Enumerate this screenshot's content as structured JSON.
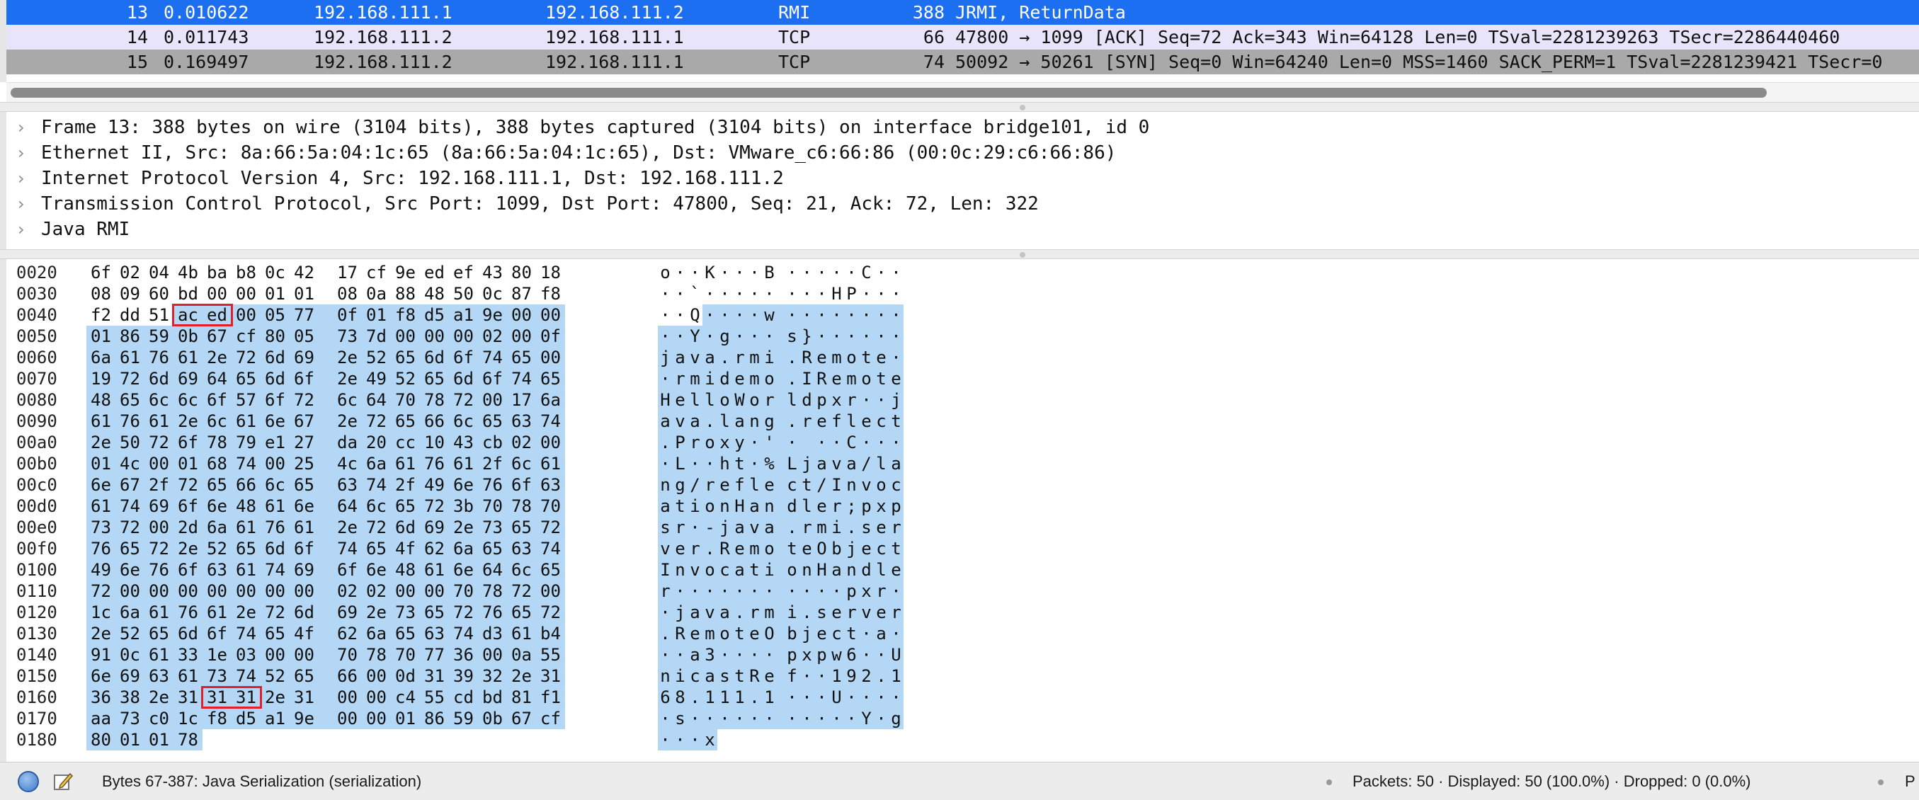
{
  "packet_list": {
    "rows": [
      {
        "no": "13",
        "time": "0.010622",
        "src": "192.168.111.1",
        "dst": "192.168.111.2",
        "proto": "RMI",
        "len": "388",
        "info": "JRMI, ReturnData"
      },
      {
        "no": "14",
        "time": "0.011743",
        "src": "192.168.111.2",
        "dst": "192.168.111.1",
        "proto": "TCP",
        "len": "66",
        "info": "47800 → 1099 [ACK] Seq=72 Ack=343 Win=64128 Len=0 TSval=2281239263 TSecr=2286440460"
      },
      {
        "no": "15",
        "time": "0.169497",
        "src": "192.168.111.2",
        "dst": "192.168.111.1",
        "proto": "TCP",
        "len": "74",
        "info": "50092 → 50261 [SYN] Seq=0 Win=64240 Len=0 MSS=1460 SACK_PERM=1 TSval=2281239421 TSecr=0"
      }
    ],
    "colors": {
      "selected": "#1d6ff2",
      "ack": "#e8e4fa",
      "syn": "#a9a9a9"
    }
  },
  "details": {
    "items": [
      {
        "label": "Frame 13: 388 bytes on wire (3104 bits), 388 bytes captured (3104 bits) on interface bridge101, id 0"
      },
      {
        "label": "Ethernet II, Src: 8a:66:5a:04:1c:65 (8a:66:5a:04:1c:65), Dst: VMware_c6:66:86 (00:0c:29:c6:66:86)"
      },
      {
        "label": "Internet Protocol Version 4, Src: 192.168.111.1, Dst: 192.168.111.2"
      },
      {
        "label": "Transmission Control Protocol, Src Port: 1099, Dst Port: 47800, Seq: 21, Ack: 72, Len: 322"
      },
      {
        "label": "Java RMI"
      }
    ],
    "collapsed_icon": "chevron-right-icon"
  },
  "bytes": {
    "highlight": {
      "start": 67,
      "end": 387,
      "color": "#b3d7f5"
    },
    "marked_ranges": [
      [
        67,
        68
      ],
      [
        356,
        357
      ]
    ],
    "mark_color": "#e0202a",
    "lines": [
      {
        "offset": "0020",
        "hex": [
          "6f",
          "02",
          "04",
          "4b",
          "ba",
          "b8",
          "0c",
          "42",
          "17",
          "cf",
          "9e",
          "ed",
          "ef",
          "43",
          "80",
          "18"
        ],
        "ascii": [
          "o",
          "·",
          "·",
          "K",
          "·",
          "·",
          "·",
          "B",
          "·",
          "·",
          "·",
          "·",
          "·",
          "C",
          "·",
          "·"
        ]
      },
      {
        "offset": "0030",
        "hex": [
          "08",
          "09",
          "60",
          "bd",
          "00",
          "00",
          "01",
          "01",
          "08",
          "0a",
          "88",
          "48",
          "50",
          "0c",
          "87",
          "f8"
        ],
        "ascii": [
          "·",
          "·",
          "`",
          "·",
          "·",
          "·",
          "·",
          "·",
          "·",
          "·",
          "·",
          "H",
          "P",
          "·",
          "·",
          "·"
        ]
      },
      {
        "offset": "0040",
        "hex": [
          "f2",
          "dd",
          "51",
          "ac",
          "ed",
          "00",
          "05",
          "77",
          "0f",
          "01",
          "f8",
          "d5",
          "a1",
          "9e",
          "00",
          "00"
        ],
        "ascii": [
          "·",
          "·",
          "Q",
          "·",
          "·",
          "·",
          "·",
          "w",
          "·",
          "·",
          "·",
          "·",
          "·",
          "·",
          "·",
          "·"
        ]
      },
      {
        "offset": "0050",
        "hex": [
          "01",
          "86",
          "59",
          "0b",
          "67",
          "cf",
          "80",
          "05",
          "73",
          "7d",
          "00",
          "00",
          "00",
          "02",
          "00",
          "0f"
        ],
        "ascii": [
          "·",
          "·",
          "Y",
          "·",
          "g",
          "·",
          "·",
          "·",
          "s",
          "}",
          "·",
          "·",
          "·",
          "·",
          "·",
          "·"
        ]
      },
      {
        "offset": "0060",
        "hex": [
          "6a",
          "61",
          "76",
          "61",
          "2e",
          "72",
          "6d",
          "69",
          "2e",
          "52",
          "65",
          "6d",
          "6f",
          "74",
          "65",
          "00"
        ],
        "ascii": [
          "j",
          "a",
          "v",
          "a",
          ".",
          "r",
          "m",
          "i",
          ".",
          "R",
          "e",
          "m",
          "o",
          "t",
          "e",
          "·"
        ]
      },
      {
        "offset": "0070",
        "hex": [
          "19",
          "72",
          "6d",
          "69",
          "64",
          "65",
          "6d",
          "6f",
          "2e",
          "49",
          "52",
          "65",
          "6d",
          "6f",
          "74",
          "65"
        ],
        "ascii": [
          "·",
          "r",
          "m",
          "i",
          "d",
          "e",
          "m",
          "o",
          ".",
          "I",
          "R",
          "e",
          "m",
          "o",
          "t",
          "e"
        ]
      },
      {
        "offset": "0080",
        "hex": [
          "48",
          "65",
          "6c",
          "6c",
          "6f",
          "57",
          "6f",
          "72",
          "6c",
          "64",
          "70",
          "78",
          "72",
          "00",
          "17",
          "6a"
        ],
        "ascii": [
          "H",
          "e",
          "l",
          "l",
          "o",
          "W",
          "o",
          "r",
          "l",
          "d",
          "p",
          "x",
          "r",
          "·",
          "·",
          "j"
        ]
      },
      {
        "offset": "0090",
        "hex": [
          "61",
          "76",
          "61",
          "2e",
          "6c",
          "61",
          "6e",
          "67",
          "2e",
          "72",
          "65",
          "66",
          "6c",
          "65",
          "63",
          "74"
        ],
        "ascii": [
          "a",
          "v",
          "a",
          ".",
          "l",
          "a",
          "n",
          "g",
          ".",
          "r",
          "e",
          "f",
          "l",
          "e",
          "c",
          "t"
        ]
      },
      {
        "offset": "00a0",
        "hex": [
          "2e",
          "50",
          "72",
          "6f",
          "78",
          "79",
          "e1",
          "27",
          "da",
          "20",
          "cc",
          "10",
          "43",
          "cb",
          "02",
          "00"
        ],
        "ascii": [
          ".",
          "P",
          "r",
          "o",
          "x",
          "y",
          "·",
          "'",
          "·",
          " ",
          "·",
          "·",
          "C",
          "·",
          "·",
          "·"
        ]
      },
      {
        "offset": "00b0",
        "hex": [
          "01",
          "4c",
          "00",
          "01",
          "68",
          "74",
          "00",
          "25",
          "4c",
          "6a",
          "61",
          "76",
          "61",
          "2f",
          "6c",
          "61"
        ],
        "ascii": [
          "·",
          "L",
          "·",
          "·",
          "h",
          "t",
          "·",
          "%",
          "L",
          "j",
          "a",
          "v",
          "a",
          "/",
          "l",
          "a"
        ]
      },
      {
        "offset": "00c0",
        "hex": [
          "6e",
          "67",
          "2f",
          "72",
          "65",
          "66",
          "6c",
          "65",
          "63",
          "74",
          "2f",
          "49",
          "6e",
          "76",
          "6f",
          "63"
        ],
        "ascii": [
          "n",
          "g",
          "/",
          "r",
          "e",
          "f",
          "l",
          "e",
          "c",
          "t",
          "/",
          "I",
          "n",
          "v",
          "o",
          "c"
        ]
      },
      {
        "offset": "00d0",
        "hex": [
          "61",
          "74",
          "69",
          "6f",
          "6e",
          "48",
          "61",
          "6e",
          "64",
          "6c",
          "65",
          "72",
          "3b",
          "70",
          "78",
          "70"
        ],
        "ascii": [
          "a",
          "t",
          "i",
          "o",
          "n",
          "H",
          "a",
          "n",
          "d",
          "l",
          "e",
          "r",
          ";",
          "p",
          "x",
          "p"
        ]
      },
      {
        "offset": "00e0",
        "hex": [
          "73",
          "72",
          "00",
          "2d",
          "6a",
          "61",
          "76",
          "61",
          "2e",
          "72",
          "6d",
          "69",
          "2e",
          "73",
          "65",
          "72"
        ],
        "ascii": [
          "s",
          "r",
          "·",
          "-",
          "j",
          "a",
          "v",
          "a",
          ".",
          "r",
          "m",
          "i",
          ".",
          "s",
          "e",
          "r"
        ]
      },
      {
        "offset": "00f0",
        "hex": [
          "76",
          "65",
          "72",
          "2e",
          "52",
          "65",
          "6d",
          "6f",
          "74",
          "65",
          "4f",
          "62",
          "6a",
          "65",
          "63",
          "74"
        ],
        "ascii": [
          "v",
          "e",
          "r",
          ".",
          "R",
          "e",
          "m",
          "o",
          "t",
          "e",
          "O",
          "b",
          "j",
          "e",
          "c",
          "t"
        ]
      },
      {
        "offset": "0100",
        "hex": [
          "49",
          "6e",
          "76",
          "6f",
          "63",
          "61",
          "74",
          "69",
          "6f",
          "6e",
          "48",
          "61",
          "6e",
          "64",
          "6c",
          "65"
        ],
        "ascii": [
          "I",
          "n",
          "v",
          "o",
          "c",
          "a",
          "t",
          "i",
          "o",
          "n",
          "H",
          "a",
          "n",
          "d",
          "l",
          "e"
        ]
      },
      {
        "offset": "0110",
        "hex": [
          "72",
          "00",
          "00",
          "00",
          "00",
          "00",
          "00",
          "00",
          "02",
          "02",
          "00",
          "00",
          "70",
          "78",
          "72",
          "00"
        ],
        "ascii": [
          "r",
          "·",
          "·",
          "·",
          "·",
          "·",
          "·",
          "·",
          "·",
          "·",
          "·",
          "·",
          "p",
          "x",
          "r",
          "·"
        ]
      },
      {
        "offset": "0120",
        "hex": [
          "1c",
          "6a",
          "61",
          "76",
          "61",
          "2e",
          "72",
          "6d",
          "69",
          "2e",
          "73",
          "65",
          "72",
          "76",
          "65",
          "72"
        ],
        "ascii": [
          "·",
          "j",
          "a",
          "v",
          "a",
          ".",
          "r",
          "m",
          "i",
          ".",
          "s",
          "e",
          "r",
          "v",
          "e",
          "r"
        ]
      },
      {
        "offset": "0130",
        "hex": [
          "2e",
          "52",
          "65",
          "6d",
          "6f",
          "74",
          "65",
          "4f",
          "62",
          "6a",
          "65",
          "63",
          "74",
          "d3",
          "61",
          "b4"
        ],
        "ascii": [
          ".",
          "R",
          "e",
          "m",
          "o",
          "t",
          "e",
          "O",
          "b",
          "j",
          "e",
          "c",
          "t",
          "·",
          "a",
          "·"
        ]
      },
      {
        "offset": "0140",
        "hex": [
          "91",
          "0c",
          "61",
          "33",
          "1e",
          "03",
          "00",
          "00",
          "70",
          "78",
          "70",
          "77",
          "36",
          "00",
          "0a",
          "55"
        ],
        "ascii": [
          "·",
          "·",
          "a",
          "3",
          "·",
          "·",
          "·",
          "·",
          "p",
          "x",
          "p",
          "w",
          "6",
          "·",
          "·",
          "U"
        ]
      },
      {
        "offset": "0150",
        "hex": [
          "6e",
          "69",
          "63",
          "61",
          "73",
          "74",
          "52",
          "65",
          "66",
          "00",
          "0d",
          "31",
          "39",
          "32",
          "2e",
          "31"
        ],
        "ascii": [
          "n",
          "i",
          "c",
          "a",
          "s",
          "t",
          "R",
          "e",
          "f",
          "·",
          "·",
          "1",
          "9",
          "2",
          ".",
          "1"
        ]
      },
      {
        "offset": "0160",
        "hex": [
          "36",
          "38",
          "2e",
          "31",
          "31",
          "31",
          "2e",
          "31",
          "00",
          "00",
          "c4",
          "55",
          "cd",
          "bd",
          "81",
          "f1"
        ],
        "ascii": [
          "6",
          "8",
          ".",
          "1",
          "1",
          "1",
          ".",
          "1",
          "·",
          "·",
          "·",
          "U",
          "·",
          "·",
          "·",
          "·"
        ]
      },
      {
        "offset": "0170",
        "hex": [
          "aa",
          "73",
          "c0",
          "1c",
          "f8",
          "d5",
          "a1",
          "9e",
          "00",
          "00",
          "01",
          "86",
          "59",
          "0b",
          "67",
          "cf"
        ],
        "ascii": [
          "·",
          "s",
          "·",
          "·",
          "·",
          "·",
          "·",
          "·",
          "·",
          "·",
          "·",
          "·",
          "·",
          "Y",
          "·",
          "g"
        ]
      },
      {
        "offset": "0180",
        "hex": [
          "80",
          "01",
          "01",
          "78"
        ],
        "ascii": [
          "·",
          "·",
          "·",
          "x"
        ]
      }
    ]
  },
  "status": {
    "expert_icon": "expert-info-icon",
    "edit_icon": "edit-comment-icon",
    "field_info": "Bytes 67-387: Java Serialization (serialization)",
    "packets": "Packets: 50 · Displayed: 50 (100.0%) · Dropped: 0 (0.0%)",
    "profile": "P"
  }
}
